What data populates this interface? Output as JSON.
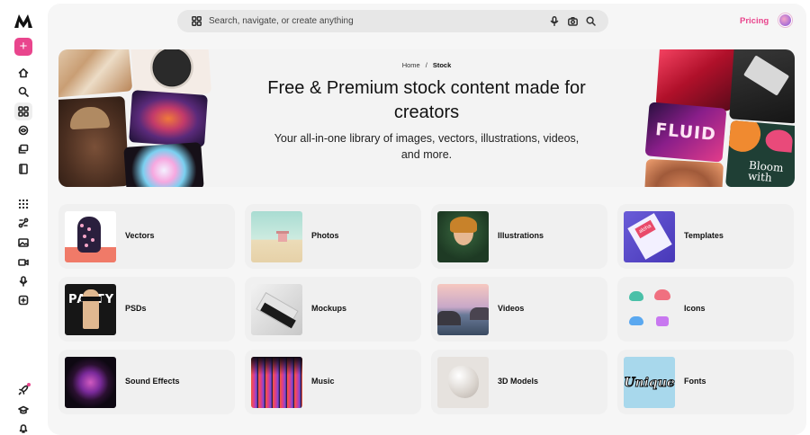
{
  "sidebar": {
    "logo": "brand-logo",
    "create_label": "+",
    "items": [
      {
        "name": "home",
        "icon": "home-icon"
      },
      {
        "name": "search",
        "icon": "search-icon"
      },
      {
        "name": "stock",
        "icon": "grid-icon",
        "active": true
      },
      {
        "name": "ai",
        "icon": "sparkle-icon"
      },
      {
        "name": "collections",
        "icon": "stack-icon"
      },
      {
        "name": "library",
        "icon": "book-icon"
      },
      {
        "name": "apps",
        "icon": "apps-icon"
      },
      {
        "name": "tools",
        "icon": "route-icon"
      },
      {
        "name": "image",
        "icon": "image-icon"
      },
      {
        "name": "video",
        "icon": "video-icon"
      },
      {
        "name": "audio",
        "icon": "mic-icon"
      },
      {
        "name": "templates",
        "icon": "template-icon"
      },
      {
        "name": "notifications-new",
        "icon": "rocket-icon"
      },
      {
        "name": "learn",
        "icon": "graduation-icon"
      },
      {
        "name": "alerts",
        "icon": "bell-icon"
      }
    ]
  },
  "header": {
    "search_placeholder": "Search, navigate, or create anything",
    "pricing_label": "Pricing"
  },
  "hero": {
    "breadcrumb": {
      "home": "Home",
      "separator": "/",
      "current": "Stock"
    },
    "title": "Free & Premium stock content made for creators",
    "subtitle": "Your all-in-one library of images, vectors, illustrations, videos, and more.",
    "tile_text": {
      "fluid": "FLUID",
      "bloom": "Bloom with"
    }
  },
  "categories": [
    {
      "label": "Vectors"
    },
    {
      "label": "Photos"
    },
    {
      "label": "Illustrations"
    },
    {
      "label": "Templates"
    },
    {
      "label": "PSDs"
    },
    {
      "label": "Mockups"
    },
    {
      "label": "Videos"
    },
    {
      "label": "Icons"
    },
    {
      "label": "Sound Effects"
    },
    {
      "label": "Music"
    },
    {
      "label": "3D Models"
    },
    {
      "label": "Fonts"
    }
  ],
  "thumb_text": {
    "psds": "PARTY",
    "fonts": "Unique",
    "templates": "aloha"
  },
  "colors": {
    "accent": "#e9458d",
    "panel": "#f6f6f6",
    "card": "#f0f0f0"
  }
}
